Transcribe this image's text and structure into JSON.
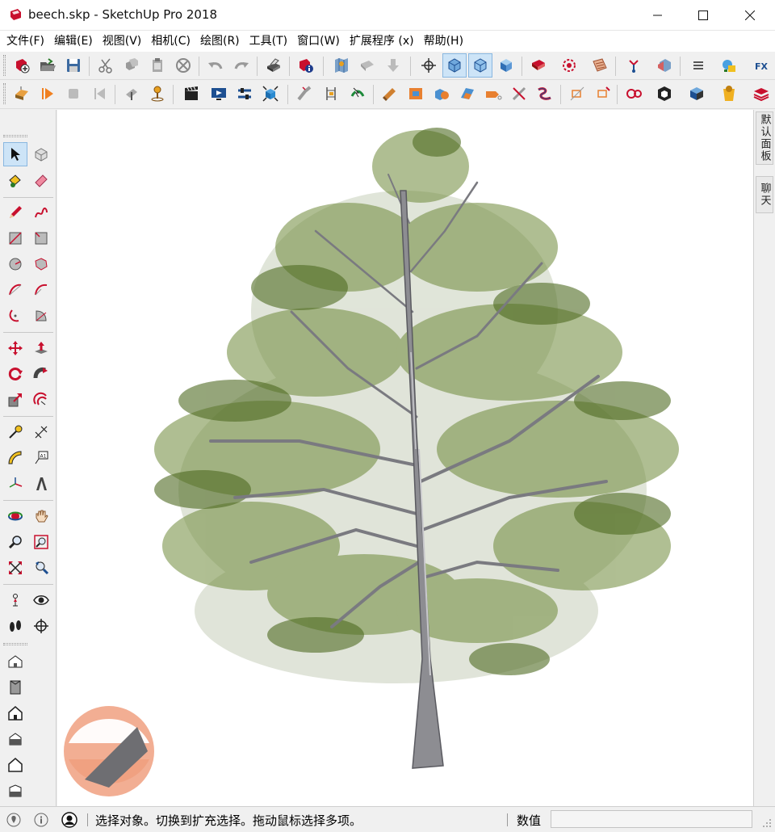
{
  "window": {
    "title": "beech.skp - SketchUp Pro 2018",
    "colors": {
      "accent": "#c8102e",
      "active_tool": "#cde4f7"
    }
  },
  "menubar": {
    "items": [
      {
        "label": "文件(F)"
      },
      {
        "label": "编辑(E)"
      },
      {
        "label": "视图(V)"
      },
      {
        "label": "相机(C)"
      },
      {
        "label": "绘图(R)"
      },
      {
        "label": "工具(T)"
      },
      {
        "label": "窗口(W)"
      },
      {
        "label": "扩展程序 (x)"
      },
      {
        "label": "帮助(H)"
      }
    ]
  },
  "toolbar1": {
    "icons": [
      "new-file-icon",
      "open-folder-icon",
      "save-icon",
      "cut-icon",
      "copy-icon",
      "paste-icon",
      "erase-delete-icon",
      "undo-icon",
      "redo-icon",
      "print-icon",
      "model-info-icon",
      "add-location-icon",
      "share-model-icon",
      "export-icon",
      "xray-axis-icon",
      "back-edges-icon",
      "wireframe-icon",
      "hidden-line-icon",
      "shaded-icon",
      "styles-icon",
      "section-plane-icon",
      "materials-icon",
      "components-icon",
      "outliner-icon",
      "extension-manager-icon",
      "fredo-fx-icon"
    ]
  },
  "toolbar2": {
    "icons": [
      "sandbox-from-contours-icon",
      "play-animation-icon",
      "stop-icon",
      "previous-scene-icon",
      "position-camera-icon",
      "look-around-icon",
      "scenes-icon",
      "presentation-icon",
      "adjust-icon",
      "dynamic-components-icon",
      "line-tool-icon",
      "dimension-icon",
      "follow-me-icon",
      "pushpull-icon",
      "offset-icon",
      "solid-tools-icon",
      "intersect-icon",
      "tag-icon",
      "knife-icon",
      "curve-icon",
      "section-display-icon",
      "section-fill-icon",
      "fredo-curviloft-icon",
      "sketchfab-icon",
      "3d-warehouse-icon",
      "vray-icon",
      "layers-stack-icon"
    ]
  },
  "left_palette": {
    "tools": [
      "select-icon",
      "make-component-icon",
      "paint-bucket-icon",
      "eraser-icon",
      "pencil-icon",
      "freehand-icon",
      "rectangle-icon",
      "rotated-rectangle-icon",
      "circle-icon",
      "polygon-icon",
      "arc-icon",
      "two-point-arc-icon",
      "three-point-arc-icon",
      "pie-icon",
      "move-icon",
      "pushpull-icon",
      "rotate-icon",
      "follow-me-icon",
      "scale-icon",
      "offset-icon",
      "tape-measure-icon",
      "dimension-icon",
      "protractor-icon",
      "text-icon",
      "axes-icon",
      "3d-text-icon",
      "orbit-icon",
      "pan-icon",
      "zoom-icon",
      "zoom-window-icon",
      "zoom-extents-icon",
      "previous-view-icon",
      "position-camera-icon",
      "look-around-icon",
      "walk-icon",
      "section-plane-icon"
    ],
    "views": [
      "iso-view-icon",
      "top-view-icon",
      "front-view-icon",
      "right-view-icon",
      "back-view-icon",
      "left-view-icon"
    ]
  },
  "right_tabs": [
    {
      "label": "默认面板"
    },
    {
      "label": "聊天"
    }
  ],
  "viewport": {
    "model": "beech-tree",
    "watermark": "brand-logo"
  },
  "statusbar": {
    "message": "选择对象。切换到扩充选择。拖动鼠标选择多项。",
    "measurements_label": "数值",
    "measurements_value": ""
  }
}
